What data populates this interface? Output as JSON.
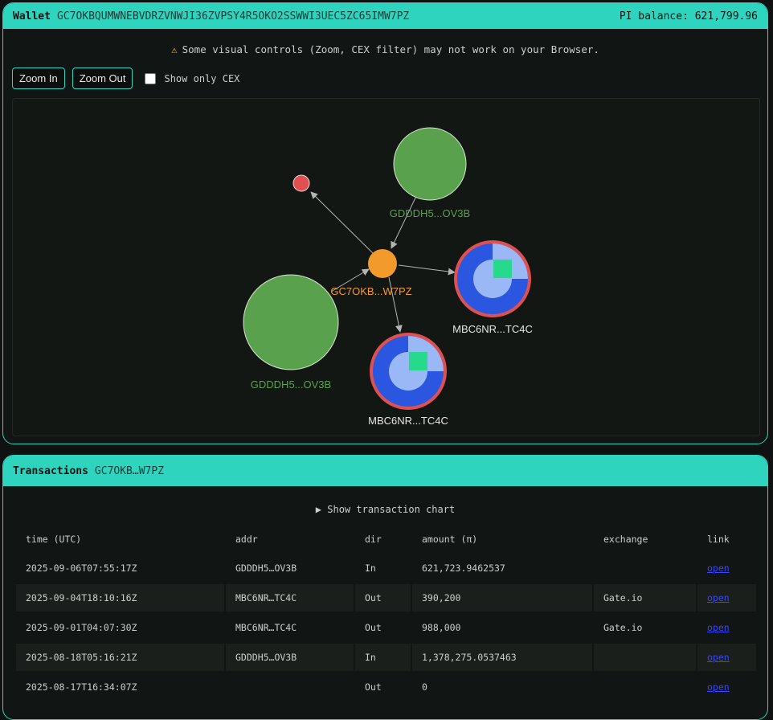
{
  "wallet": {
    "label": "Wallet",
    "address": "GC7OKBQUMWNEBVDRZVNWJI36ZVPSY4R5OKO2SSWWI3UEC5ZC65IMW7PZ",
    "balance": "PI balance: 621,799.96"
  },
  "notice": {
    "icon": "warning-icon",
    "text": "Some visual controls (Zoom, CEX filter) may not work on your Browser."
  },
  "controls": {
    "zoom_in": "Zoom In",
    "zoom_out": "Zoom Out",
    "cex_label": "Show only CEX",
    "cex_checked": false
  },
  "graph": {
    "nodes": [
      {
        "id": "top_green",
        "label": "GDDDH5...OV3B",
        "color": "#5aa14e"
      },
      {
        "id": "left_green",
        "label": "GDDDH5...OV3B",
        "color": "#5aa14e"
      },
      {
        "id": "red",
        "label": "",
        "color": "#e05050"
      },
      {
        "id": "center",
        "label": "GC7OKB...W7PZ",
        "color": "#f39a2c"
      },
      {
        "id": "cex_right",
        "label": "MBC6NR...TC4C",
        "color": "#2a56e0"
      },
      {
        "id": "cex_bottom",
        "label": "MBC6NR...TC4C",
        "color": "#2a56e0"
      }
    ],
    "edges": [
      {
        "from": "top_green",
        "to": "center"
      },
      {
        "from": "left_green",
        "to": "center"
      },
      {
        "from": "center",
        "to": "red"
      },
      {
        "from": "center",
        "to": "cex_right"
      },
      {
        "from": "center",
        "to": "cex_bottom"
      }
    ]
  },
  "transactions": {
    "label": "Transactions",
    "address": "GC7OKB…W7PZ",
    "chart_toggle": "▶ Show transaction chart",
    "columns": [
      "time (UTC)",
      "addr",
      "dir",
      "amount (π)",
      "exchange",
      "link"
    ],
    "rows": [
      {
        "time": "2025-09-06T07:55:17Z",
        "addr": "GDDDH5…OV3B",
        "dir": "In",
        "amount": "621,723.9462537",
        "exchange": "",
        "link": "open"
      },
      {
        "time": "2025-09-04T18:10:16Z",
        "addr": "MBC6NR…TC4C",
        "dir": "Out",
        "amount": "390,200",
        "exchange": "Gate.io",
        "link": "open"
      },
      {
        "time": "2025-09-01T04:07:30Z",
        "addr": "MBC6NR…TC4C",
        "dir": "Out",
        "amount": "988,000",
        "exchange": "Gate.io",
        "link": "open"
      },
      {
        "time": "2025-08-18T05:16:21Z",
        "addr": "GDDDH5…OV3B",
        "dir": "In",
        "amount": "1,378,275.0537463",
        "exchange": "",
        "link": "open"
      },
      {
        "time": "2025-08-17T16:34:07Z",
        "addr": "",
        "dir": "Out",
        "amount": "0",
        "exchange": "",
        "link": "open"
      }
    ]
  }
}
